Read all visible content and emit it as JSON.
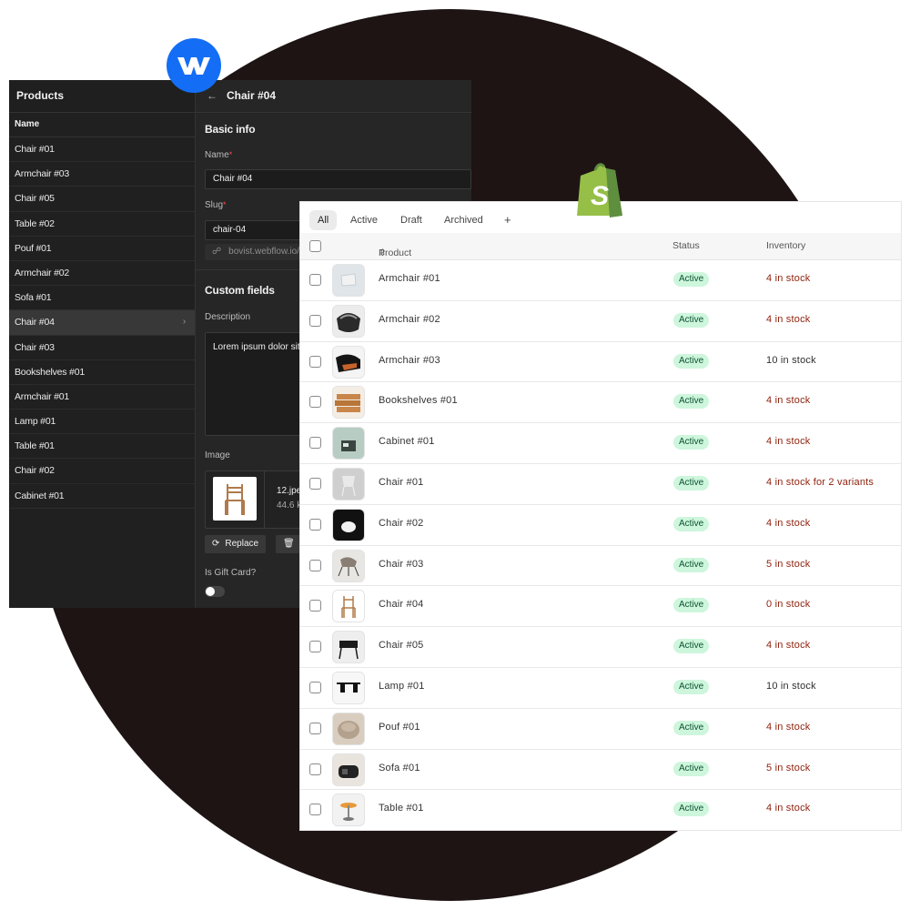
{
  "webflow": {
    "collection_title": "Products",
    "column_header": "Name",
    "items": [
      {
        "label": "Chair #01"
      },
      {
        "label": "Armchair #03"
      },
      {
        "label": "Chair #05"
      },
      {
        "label": "Table #02"
      },
      {
        "label": "Pouf #01"
      },
      {
        "label": "Armchair #02"
      },
      {
        "label": "Sofa #01"
      },
      {
        "label": "Chair #04",
        "selected": true
      },
      {
        "label": "Chair #03"
      },
      {
        "label": "Bookshelves #01"
      },
      {
        "label": "Armchair #01"
      },
      {
        "label": "Lamp #01"
      },
      {
        "label": "Table #01"
      },
      {
        "label": "Chair #02"
      },
      {
        "label": "Cabinet #01"
      }
    ],
    "editor": {
      "back_arrow": "←",
      "title": "Chair #04",
      "basic_info": "Basic info",
      "name_label": "Name",
      "name_value": "Chair #04",
      "slug_label": "Slug",
      "slug_value": "chair-04",
      "slug_url": "bovist.webflow.io/p",
      "required_mark": "*",
      "custom_fields": "Custom fields",
      "description_label": "Description",
      "description_value": "Lorem ipsum dolor sit",
      "image_label": "Image",
      "image_filename": "12.jpe",
      "image_size": "44.6 k",
      "replace_label": "Replace",
      "gift_card_label": "Is Gift Card?",
      "gift_card_on": false
    }
  },
  "shopify": {
    "tabs": [
      "All",
      "Active",
      "Draft",
      "Archived",
      "+"
    ],
    "active_tab": "All",
    "columns": {
      "product": "Product",
      "status": "Status",
      "inventory": "Inventory"
    },
    "rows": [
      {
        "name": "Armchair #01",
        "status": "Active",
        "inventory": "4 in stock",
        "low": true,
        "icon": "armchair-01-thumb"
      },
      {
        "name": "Armchair #02",
        "status": "Active",
        "inventory": "4 in stock",
        "low": true,
        "icon": "armchair-02-thumb"
      },
      {
        "name": "Armchair #03",
        "status": "Active",
        "inventory": "10 in stock",
        "low": false,
        "icon": "armchair-03-thumb"
      },
      {
        "name": "Bookshelves #01",
        "status": "Active",
        "inventory": "4 in stock",
        "low": true,
        "icon": "bookshelves-thumb"
      },
      {
        "name": "Cabinet #01",
        "status": "Active",
        "inventory": "4 in stock",
        "low": true,
        "icon": "cabinet-thumb"
      },
      {
        "name": "Chair #01",
        "status": "Active",
        "inventory": "4 in stock for 2 variants",
        "low": true,
        "icon": "chair-01-thumb"
      },
      {
        "name": "Chair #02",
        "status": "Active",
        "inventory": "4 in stock",
        "low": true,
        "icon": "chair-02-thumb"
      },
      {
        "name": "Chair #03",
        "status": "Active",
        "inventory": "5 in stock",
        "low": true,
        "icon": "chair-03-thumb"
      },
      {
        "name": "Chair #04",
        "status": "Active",
        "inventory": "0 in stock",
        "low": true,
        "icon": "chair-04-thumb"
      },
      {
        "name": "Chair #05",
        "status": "Active",
        "inventory": "4 in stock",
        "low": true,
        "icon": "chair-05-thumb"
      },
      {
        "name": "Lamp #01",
        "status": "Active",
        "inventory": "10 in stock",
        "low": false,
        "icon": "lamp-thumb"
      },
      {
        "name": "Pouf #01",
        "status": "Active",
        "inventory": "4 in stock",
        "low": true,
        "icon": "pouf-thumb"
      },
      {
        "name": "Sofa #01",
        "status": "Active",
        "inventory": "5 in stock",
        "low": true,
        "icon": "sofa-thumb"
      },
      {
        "name": "Table #01",
        "status": "Active",
        "inventory": "4 in stock",
        "low": true,
        "icon": "table-thumb"
      }
    ]
  },
  "colors": {
    "background_circle": "#1e1414",
    "webflow_blue": "#146ef5",
    "shopify_green": "#95bf47",
    "active_badge": "#cdf6dc",
    "low_stock": "#8e1f0b"
  }
}
